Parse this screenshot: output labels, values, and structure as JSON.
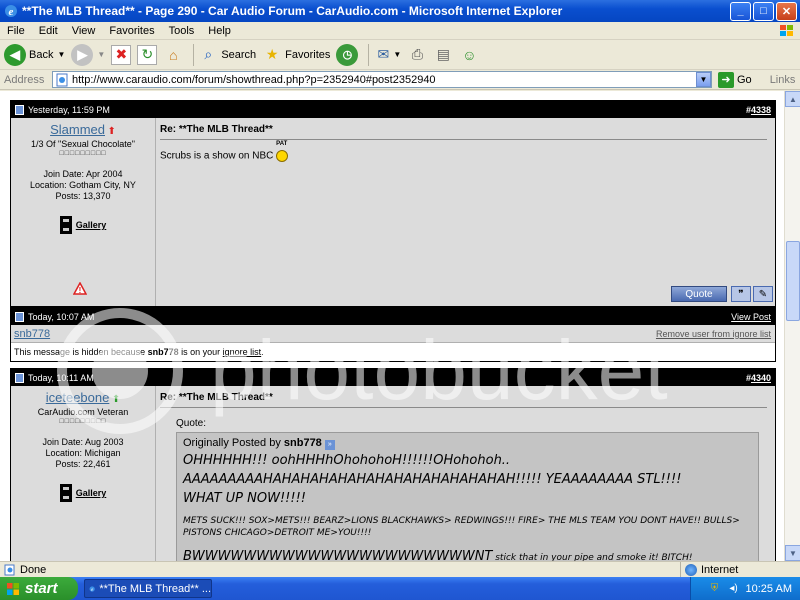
{
  "window": {
    "title": "**The MLB Thread** - Page 290 - Car Audio Forum - CarAudio.com - Microsoft Internet Explorer",
    "min": "_",
    "max": "□",
    "close": "✕"
  },
  "menu": [
    "File",
    "Edit",
    "View",
    "Favorites",
    "Tools",
    "Help"
  ],
  "toolbar": {
    "back": "Back",
    "search": "Search",
    "favorites": "Favorites"
  },
  "address": {
    "label": "Address",
    "url": "http://www.caraudio.com/forum/showthread.php?p=2352940#post2352940",
    "go": "Go",
    "links": "Links"
  },
  "posts": {
    "post1": {
      "date": "Yesterday, 11:59 PM",
      "number_prefix": "#",
      "number": "4338",
      "username": "Slammed",
      "user_title": "1/3 Of \"Sexual Chocolate\"",
      "rep": "□□□□□□□□□",
      "join": "Join Date: Apr 2004",
      "location": "Location: Gotham City, NY",
      "posts": "Posts: 13,370",
      "gallery": "Gallery",
      "title": "Re: **The MLB Thread**",
      "text": "Scrubs is a show on NBC",
      "smiley_label": "PAT",
      "quote_btn": "Quote"
    },
    "hidden": {
      "date": "Today, 10:07 AM",
      "view_post": "View Post",
      "username": "snb778",
      "remove": "Remove user from ignore list",
      "note_pre": "This message is hidden because ",
      "note_user": "snb778",
      "note_mid": " is on your ",
      "note_link": "ignore list",
      "note_end": "."
    },
    "post2": {
      "date": "Today, 10:11 AM",
      "number_prefix": "#",
      "number": "4340",
      "username": "iceteebone",
      "user_title": "CarAudio.com Veteran",
      "rep": "□□□□□□□□□",
      "join": "Join Date: Aug 2003",
      "location": "Location: Michigan",
      "posts": "Posts: 22,461",
      "gallery": "Gallery",
      "title": "Re: **The MLB Thread**",
      "quote_label": "Quote:",
      "quote_by_prefix": "Originally Posted by ",
      "quote_by_user": "snb778",
      "quote_line1": "OHHHHHH!!! oohHHHhOhohohoH!!!!!!OHohohoh..",
      "quote_line2": "AAAAAAAAAHAHAHAHAHAHAHAHAHAHAHAHAHAH!!!!! YEAAAAAAAA STL!!!!",
      "quote_line3": "WHAT UP NOW!!!!!",
      "quote_small": "METS SUCK!!! SOX>METS!!! BEARZ>LIONS BLACKHAWKS> REDWINGS!!! FIRE> THE MLS TEAM YOU DONT HAVE!! BULLS> PISTONS CHICAGO>DETROIT ME>YOU!!!!",
      "quote_bw": "BWWWWWWWWWWWWWWWWWWWWWWNT",
      "quote_bw_tail": " stick that in your pipe and smoke it! BITCH!"
    }
  },
  "watermark": "photobucket",
  "status": {
    "text": "Done",
    "zone": "Internet"
  },
  "taskbar": {
    "start": "start",
    "task": "**The MLB Thread** ...",
    "clock": "10:25 AM"
  }
}
